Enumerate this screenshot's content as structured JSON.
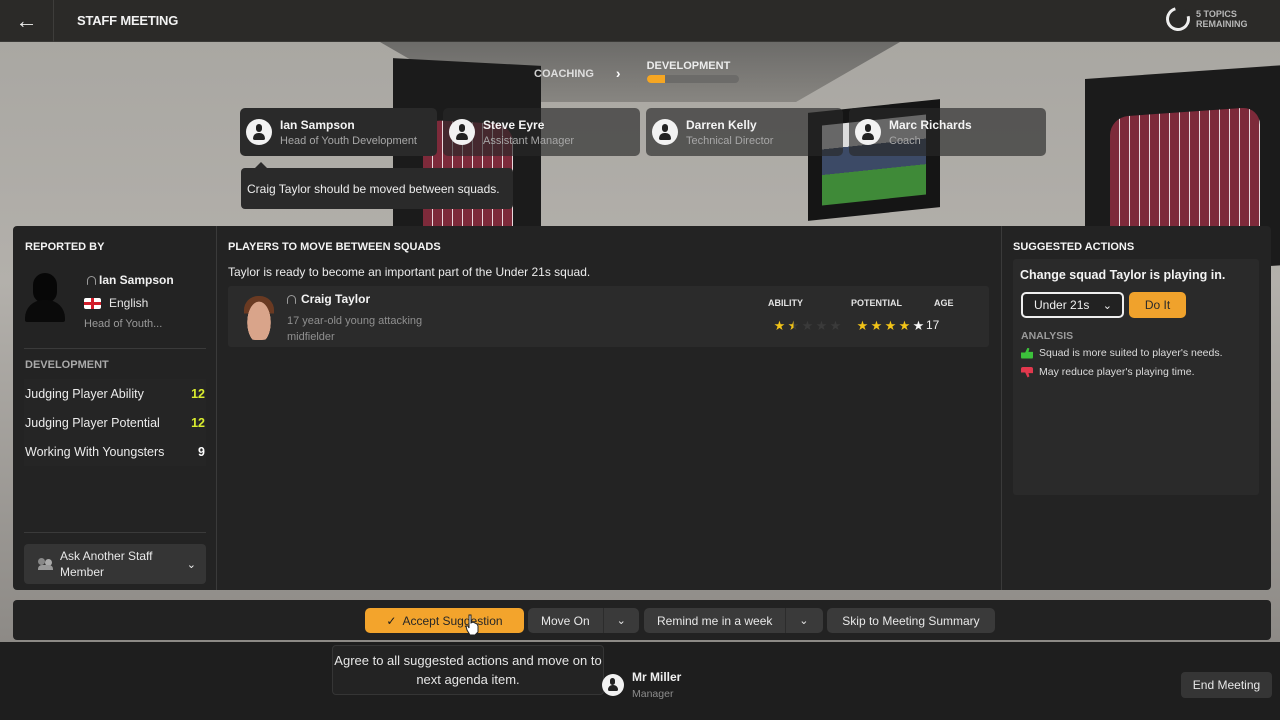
{
  "header": {
    "back_icon": "arrow-left-icon",
    "title": "STAFF MEETING",
    "topics_remaining": "5 TOPICS REMAINING",
    "topics_icon": "progress-ring-icon"
  },
  "stages": {
    "items": [
      {
        "label": "COACHING",
        "active": false
      },
      {
        "label": "DEVELOPMENT",
        "active": true
      }
    ],
    "separator_icon": "chevron-right-icon",
    "development_progress_percent": 20
  },
  "staff": [
    {
      "name": "Ian Sampson",
      "role": "Head of Youth Development",
      "active": true
    },
    {
      "name": "Steve Eyre",
      "role": "Assistant Manager",
      "active": false
    },
    {
      "name": "Darren Kelly",
      "role": "Technical Director",
      "active": false
    },
    {
      "name": "Marc Richards",
      "role": "Coach",
      "active": false
    }
  ],
  "speech_bubble": "Craig Taylor should be moved between squads.",
  "reported_by": {
    "title": "REPORTED BY",
    "name": "Ian Sampson",
    "nationality": "English",
    "role": "Head of Youth...",
    "development_title": "DEVELOPMENT",
    "attributes": [
      {
        "label": "Judging Player Ability",
        "value": "12",
        "highlight": true
      },
      {
        "label": "Judging Player Potential",
        "value": "12",
        "highlight": true
      },
      {
        "label": "Working With Youngsters",
        "value": "9",
        "highlight": false
      }
    ],
    "ask_button": "Ask Another Staff Member"
  },
  "players_section": {
    "title": "PLAYERS TO MOVE BETWEEN SQUADS",
    "description": "Taylor is ready to become an important part of the Under 21s squad.",
    "player": {
      "name": "Craig Taylor",
      "description": "17 year-old young attacking midfielder",
      "ability_label": "ABILITY",
      "potential_label": "POTENTIAL",
      "age_label": "AGE",
      "ability_stars": 1.5,
      "potential_stars": 5,
      "potential_stars_gold": 4,
      "age": "17"
    }
  },
  "suggested_actions": {
    "title": "SUGGESTED ACTIONS",
    "action_text": "Change squad Taylor is playing in.",
    "squad_selected": "Under 21s",
    "do_it_label": "Do It",
    "analysis_title": "ANALYSIS",
    "analysis": [
      {
        "type": "positive",
        "text": "Squad is more suited to player's needs."
      },
      {
        "type": "negative",
        "text": "May reduce player's playing time."
      }
    ]
  },
  "action_bar": {
    "accept_label": "Accept Suggestion",
    "move_on_label": "Move On",
    "remind_label": "Remind me in a week",
    "skip_label": "Skip to Meeting Summary"
  },
  "tooltip": "Agree to all suggested actions and move on to next agenda item.",
  "manager": {
    "name": "Mr Miller",
    "role": "Manager"
  },
  "end_meeting_label": "End Meeting",
  "colors": {
    "accent": "#f3a42c",
    "highlight_attr": "#d9ec2f",
    "star_gold": "#f2c418",
    "positive": "#3cc13b",
    "negative": "#e2384d"
  }
}
